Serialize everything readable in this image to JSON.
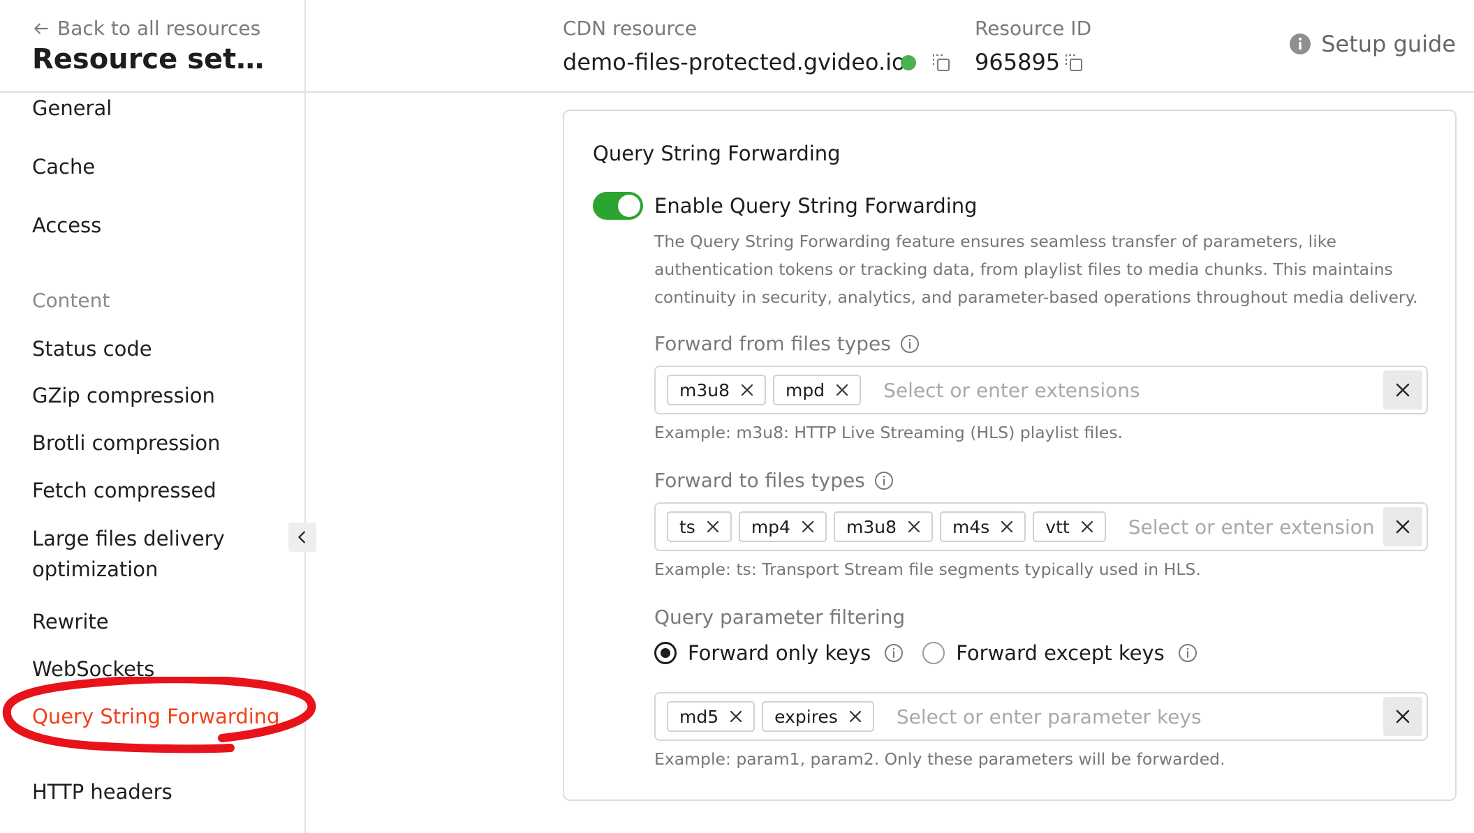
{
  "sidebar": {
    "back_label": "Back to all resources",
    "title": "Resource settings",
    "items": [
      {
        "label": "General"
      },
      {
        "label": "Cache"
      },
      {
        "label": "Access"
      },
      {
        "label": "Status code"
      },
      {
        "label": "GZip compression"
      },
      {
        "label": "Brotli compression"
      },
      {
        "label": "Fetch compressed"
      },
      {
        "label": "Large files delivery"
      },
      {
        "label": "optimization"
      },
      {
        "label": "Rewrite"
      },
      {
        "label": "WebSockets"
      },
      {
        "label": "Query String Forwarding",
        "active": true
      },
      {
        "label": "HTTP headers"
      }
    ],
    "section_content": "Content",
    "active_color": "#f0421c",
    "highlight_color": "#e8121a"
  },
  "header": {
    "cdn_label": "CDN resource",
    "cdn_value": "demo-files-protected.gvideo.io",
    "cdn_status_color": "#4caf50",
    "resource_id_label": "Resource ID",
    "resource_id_value": "965895",
    "setup_guide_label": "Setup guide",
    "icons": [
      "copy-icon",
      "info-icon"
    ]
  },
  "card": {
    "title": "Query String Forwarding",
    "toggle_label": "Enable Query String Forwarding",
    "toggle_on": true,
    "toggle_color": "#2ca42f",
    "description": "The Query String Forwarding feature ensures seamless transfer of parameters, like authentication tokens or tracking data, from playlist files to media chunks. This maintains continuity in security, analytics, and parameter-based operations throughout media delivery.",
    "from_types": {
      "label": "Forward from files types",
      "tags": [
        "m3u8",
        "mpd"
      ],
      "placeholder": "Select or enter extensions",
      "example": "Example: m3u8: HTTP Live Streaming (HLS) playlist files."
    },
    "to_types": {
      "label": "Forward to files types",
      "tags": [
        "ts",
        "mp4",
        "m3u8",
        "m4s",
        "vtt"
      ],
      "placeholder": "Select or enter extensions",
      "example": "Example: ts: Transport Stream file segments typically used in HLS."
    },
    "filtering": {
      "label": "Query parameter filtering",
      "option_only": "Forward only keys",
      "option_except": "Forward except keys",
      "selected": "only",
      "tags": [
        "md5",
        "expires"
      ],
      "placeholder": "Select or enter parameter keys",
      "example": "Example: param1, param2. Only these parameters will be forwarded."
    }
  }
}
